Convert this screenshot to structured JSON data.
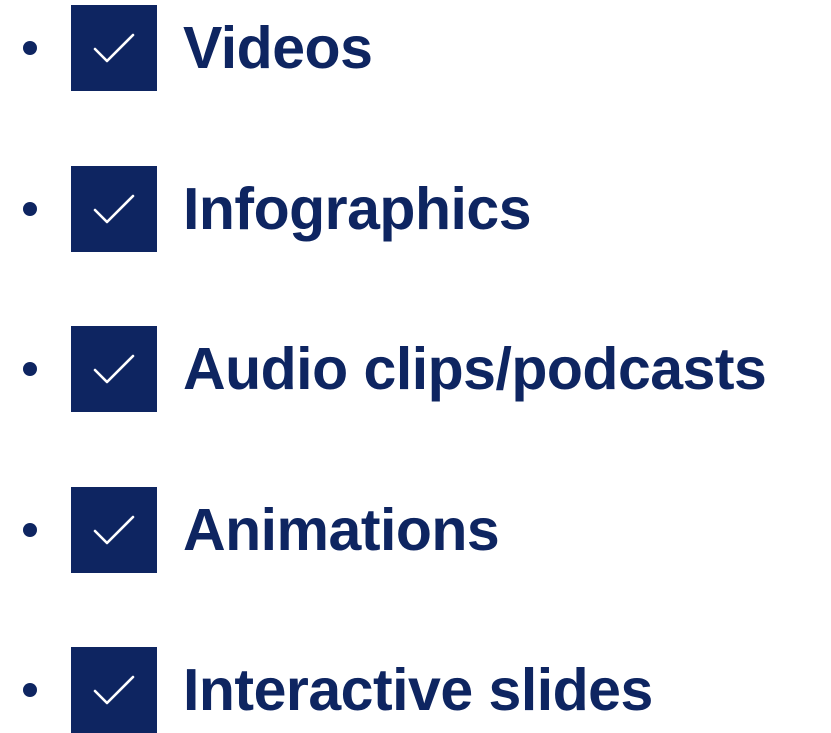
{
  "colors": {
    "text": "#0e2561",
    "box": "#0e2561",
    "check": "#ffffff",
    "background": "#ffffff"
  },
  "items": [
    {
      "label": "Videos",
      "checked": true,
      "icon": "checkmark-icon"
    },
    {
      "label": "Infographics",
      "checked": true,
      "icon": "checkmark-icon"
    },
    {
      "label": "Audio clips/podcasts",
      "checked": true,
      "icon": "checkmark-icon"
    },
    {
      "label": "Animations",
      "checked": true,
      "icon": "checkmark-icon"
    },
    {
      "label": "Interactive slides",
      "checked": true,
      "icon": "checkmark-icon"
    }
  ]
}
